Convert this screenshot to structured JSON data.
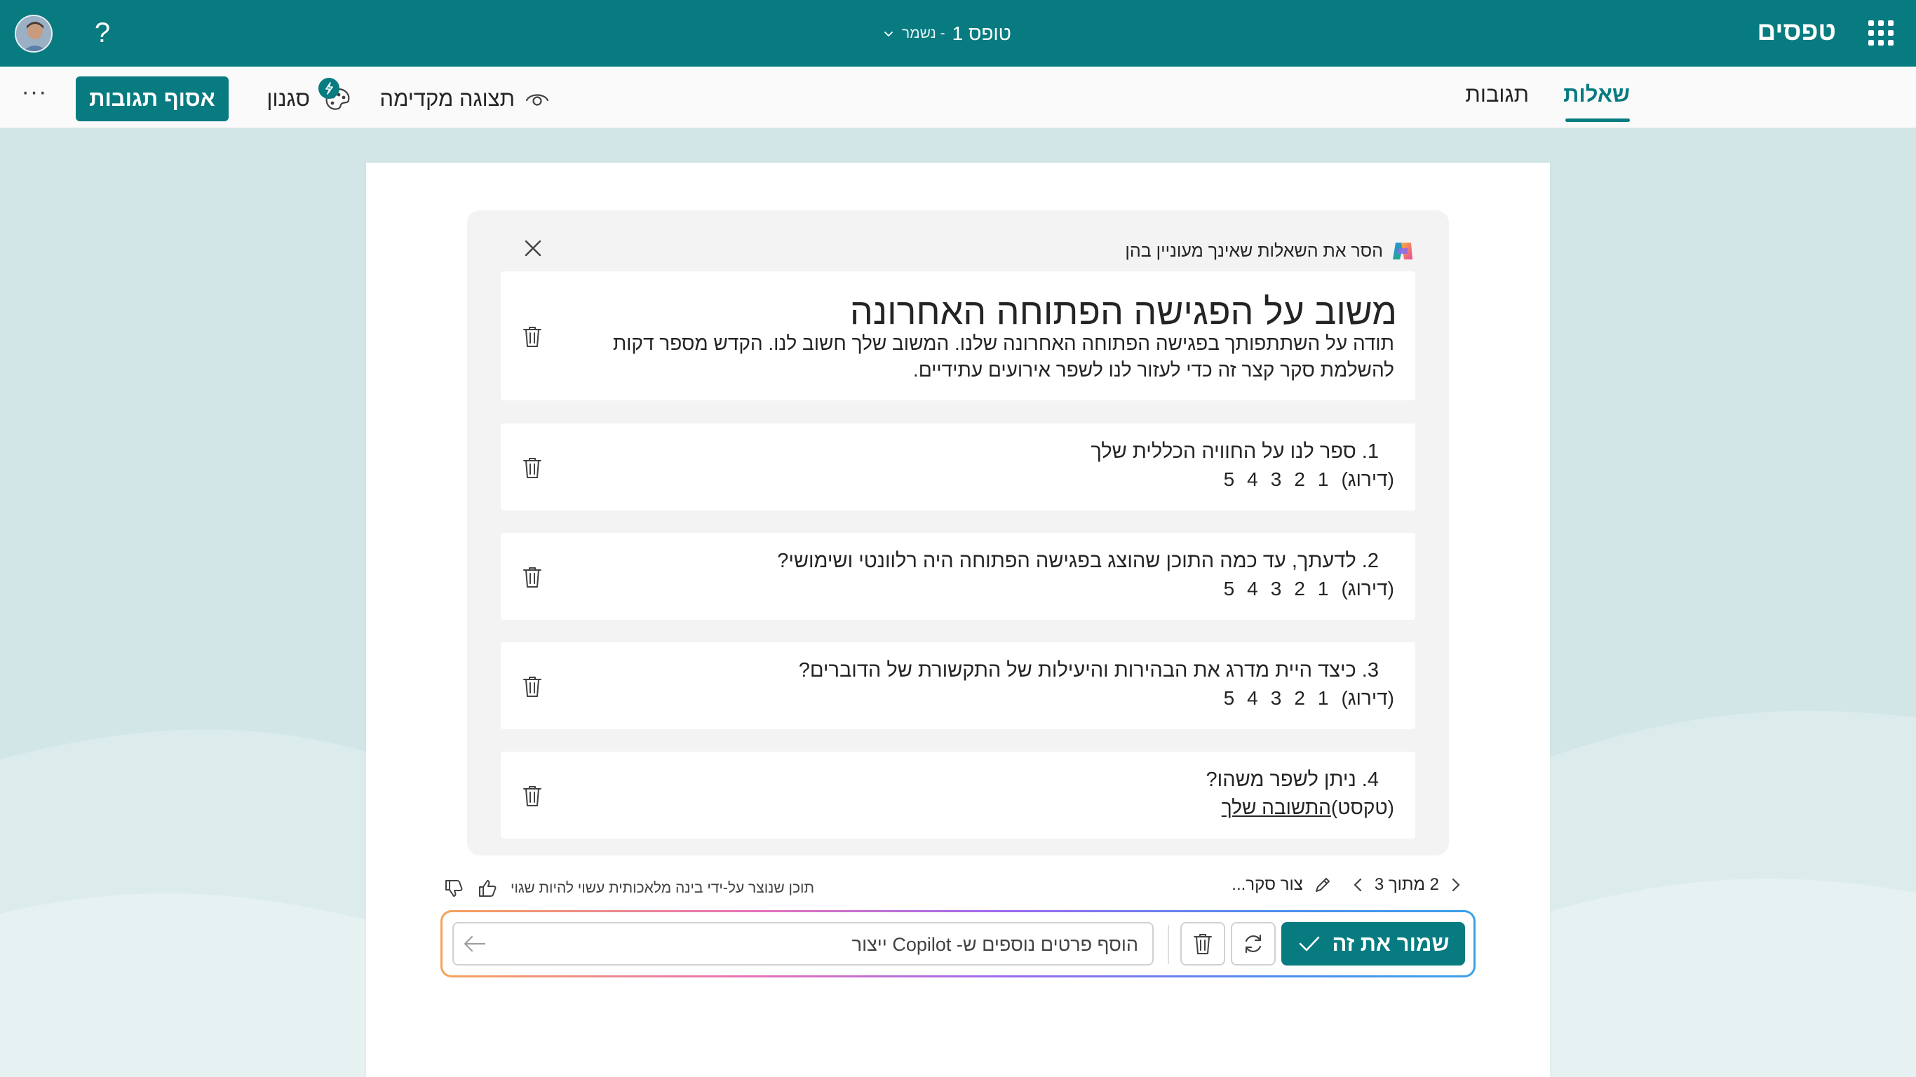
{
  "topbar": {
    "app_name": "טפסים",
    "doc_title": "טופס 1",
    "doc_status": "- נשמר",
    "help_label": "?"
  },
  "cmdbar": {
    "collect_label": "אסוף תגובות",
    "style_label": "סגנון",
    "preview_label": "תצוגה מקדימה",
    "more_label": "···",
    "tabs": [
      {
        "label": "שאלות",
        "active": true
      },
      {
        "label": "תגובות",
        "active": false
      }
    ]
  },
  "panel": {
    "header": "הסר את השאלות שאינך מעוניין בהן",
    "form_title": "משוב על הפגישה הפתוחה האחרונה",
    "form_description": "תודה על השתתפותך בפגישה הפתוחה האחרונה שלנו. המשוב שלך חשוב לנו. הקדש מספר דקות להשלמת סקר קצר זה כדי לעזור לנו לשפר אירועים עתידיים.",
    "questions": [
      {
        "text": "1. ספר לנו על החוויה הכללית שלך",
        "type": "(דירוג)",
        "scale": [
          "1",
          "2",
          "3",
          "4",
          "5"
        ]
      },
      {
        "text": "2. לדעתך, עד כמה התוכן שהוצג בפגישה הפתוחה היה רלוונטי ושימושי?",
        "type": "(דירוג)",
        "scale": [
          "1",
          "2",
          "3",
          "4",
          "5"
        ]
      },
      {
        "text": "3. כיצד היית מדרג את הבהירות והיעילות של התקשורת של הדוברים?",
        "type": "(דירוג)",
        "scale": [
          "1",
          "2",
          "3",
          "4",
          "5"
        ]
      },
      {
        "text": "4. ניתן לשפר משהו?",
        "type": "(טקסט)",
        "answer_placeholder": "התשובה שלך"
      }
    ]
  },
  "footer": {
    "pager": "2 מתוך 3",
    "create_label": "צור סקר...",
    "ai_note": "תוכן שנוצר על-ידי בינה מלאכותית עשוי להיות שגוי"
  },
  "composer": {
    "placeholder": "הוסף פרטים נוספים ש- Copilot ייצור",
    "save_label": "שמור את זה"
  },
  "colors": {
    "brand": "#077b80",
    "background": "#d3e6e7",
    "panel": "#f3f3f3"
  }
}
